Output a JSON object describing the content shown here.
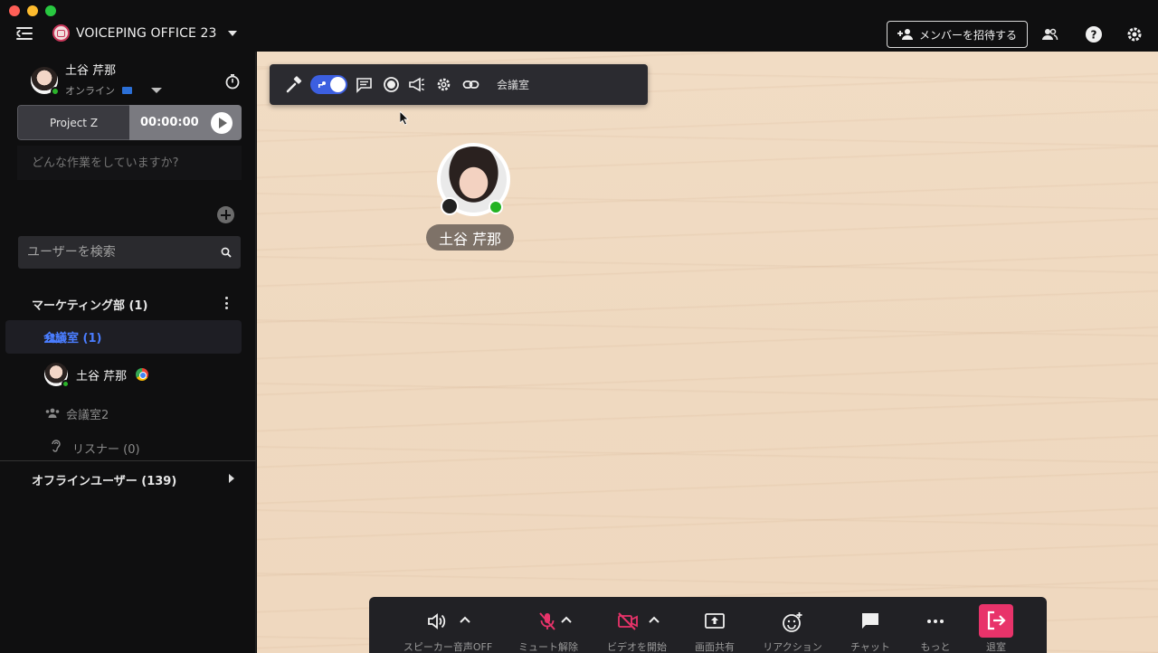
{
  "window": {
    "workspace_name": "VOICEPING OFFICE 23",
    "invite_label": "メンバーを招待する"
  },
  "sidebar": {
    "me": {
      "name": "土谷 芹那",
      "status": "オンライン"
    },
    "project": {
      "name": "Project Z",
      "timer": "00:00:00"
    },
    "task_placeholder": "どんな作業をしていますか?",
    "search_placeholder": "ユーザーを検索",
    "department": "マーケティング部 (1)",
    "active_room": "会議室 (1)",
    "members": [
      {
        "name": "土谷 芹那"
      }
    ],
    "room2": "会議室2",
    "listener": "リスナー (0)",
    "offline_users": "オフラインユーザー (139)"
  },
  "stage": {
    "room_label": "会議室",
    "user_tag": "土谷 芹那"
  },
  "controls": {
    "speaker": "スピーカー音声OFF",
    "unmute": "ミュート解除",
    "video": "ビデオを開始",
    "share": "画面共有",
    "reaction": "リアクション",
    "chat": "チャット",
    "more": "もっと",
    "leave": "退室"
  },
  "colors": {
    "accent_blue": "#4a7dff",
    "online_green": "#2bb32b",
    "muted_pink": "#e8336a"
  }
}
